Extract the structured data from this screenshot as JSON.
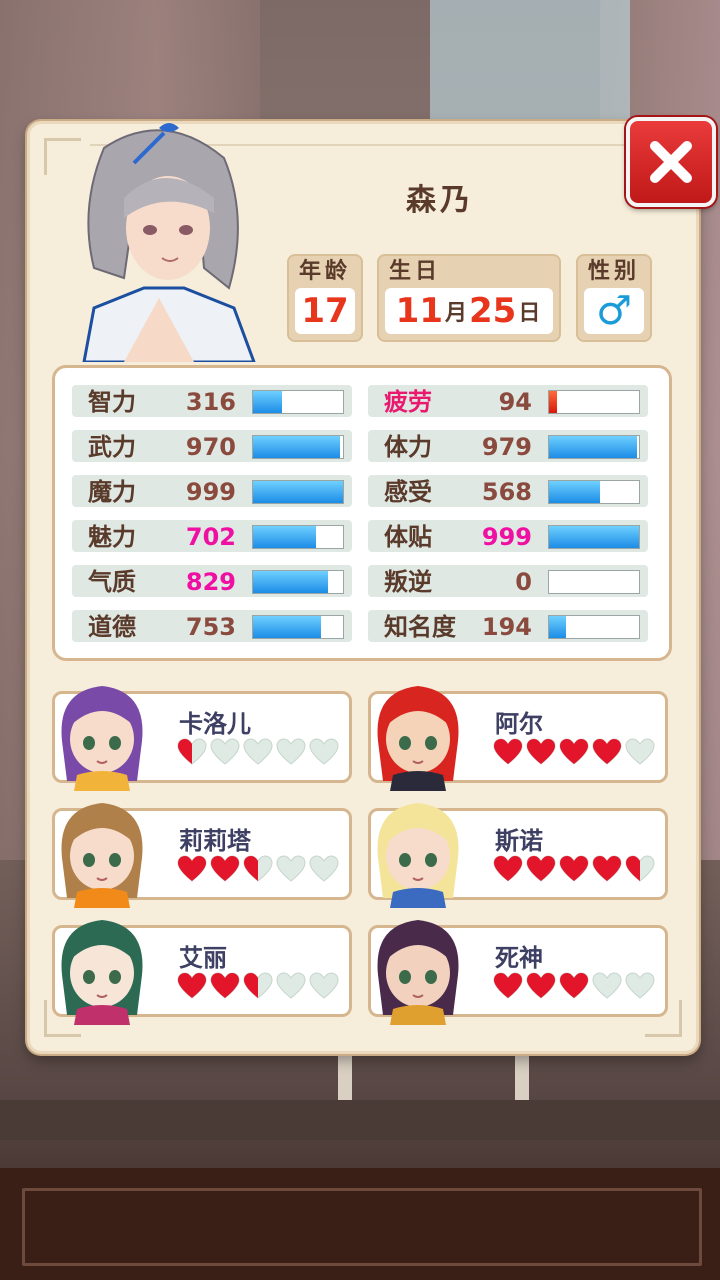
{
  "character": {
    "name": "森乃",
    "age_label": "年龄",
    "age": "17",
    "birthday_label": "生日",
    "birthday_month": "11",
    "birthday_month_unit": "月",
    "birthday_day": "25",
    "birthday_day_unit": "日",
    "gender_label": "性别",
    "gender": "♂"
  },
  "stats_left": [
    {
      "name": "智力",
      "value": "316",
      "fill": 0.32
    },
    {
      "name": "武力",
      "value": "970",
      "fill": 0.97
    },
    {
      "name": "魔力",
      "value": "999",
      "fill": 1.0
    },
    {
      "name": "魅力",
      "value": "702",
      "fill": 0.7,
      "highlight": true
    },
    {
      "name": "气质",
      "value": "829",
      "fill": 0.83,
      "highlight": true
    },
    {
      "name": "道德",
      "value": "753",
      "fill": 0.75
    }
  ],
  "stats_right": [
    {
      "name": "疲劳",
      "value": "94",
      "fill": 0.09,
      "bar_color": "red",
      "name_color": "pink"
    },
    {
      "name": "体力",
      "value": "979",
      "fill": 0.98
    },
    {
      "name": "感受",
      "value": "568",
      "fill": 0.57
    },
    {
      "name": "体贴",
      "value": "999",
      "fill": 1.0,
      "highlight": true
    },
    {
      "name": "叛逆",
      "value": "0",
      "fill": 0.0
    },
    {
      "name": "知名度",
      "value": "194",
      "fill": 0.19
    }
  ],
  "relations": [
    {
      "name": "卡洛儿",
      "hearts": 0.5
    },
    {
      "name": "阿尔",
      "hearts": 4
    },
    {
      "name": "莉莉塔",
      "hearts": 2.5
    },
    {
      "name": "斯诺",
      "hearts": 4.5
    },
    {
      "name": "艾丽",
      "hearts": 2.5
    },
    {
      "name": "死神",
      "hearts": 3
    }
  ],
  "colors": {
    "accent_red": "#e8361d",
    "stat_highlight": "#ef0fa3",
    "bar_blue": "#1c8ce6",
    "heart_red": "#e3152b",
    "heart_empty": "#dfeae4"
  }
}
